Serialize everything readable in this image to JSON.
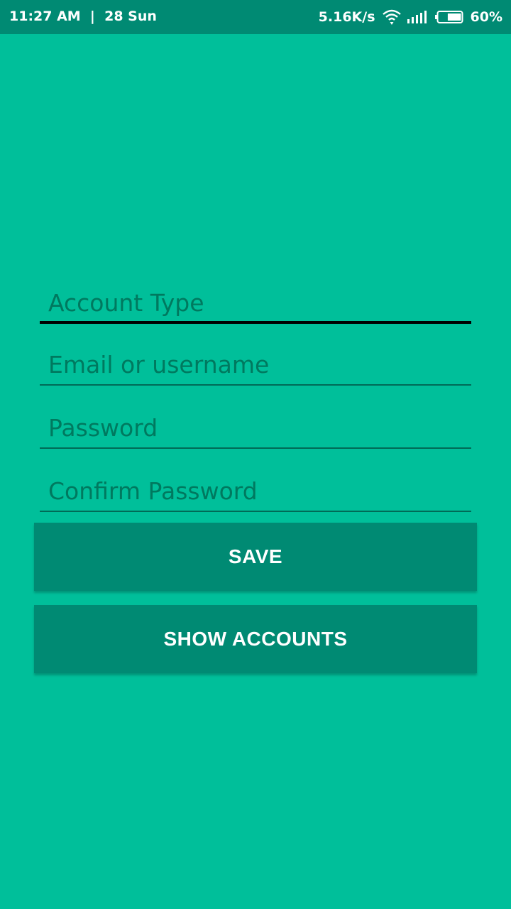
{
  "status_bar": {
    "time_date": "11:27 AM  |  28 Sun",
    "network_speed": "5.16K/s",
    "battery": "60%",
    "icons": [
      "wifi-icon",
      "signal-icon",
      "battery-icon"
    ],
    "battery_level": 0.6
  },
  "form": {
    "account_type_placeholder": "Account Type",
    "email_placeholder": "Email or username",
    "password_placeholder": "Password",
    "confirm_password_placeholder": "Confirm Password"
  },
  "buttons": {
    "save_label": "SAVE",
    "show_accounts_label": "SHOW ACCOUNTS"
  },
  "colors": {
    "background": "#00bf9a",
    "status_bar": "#008a73",
    "button": "#008a73",
    "placeholder": "#00795f"
  }
}
